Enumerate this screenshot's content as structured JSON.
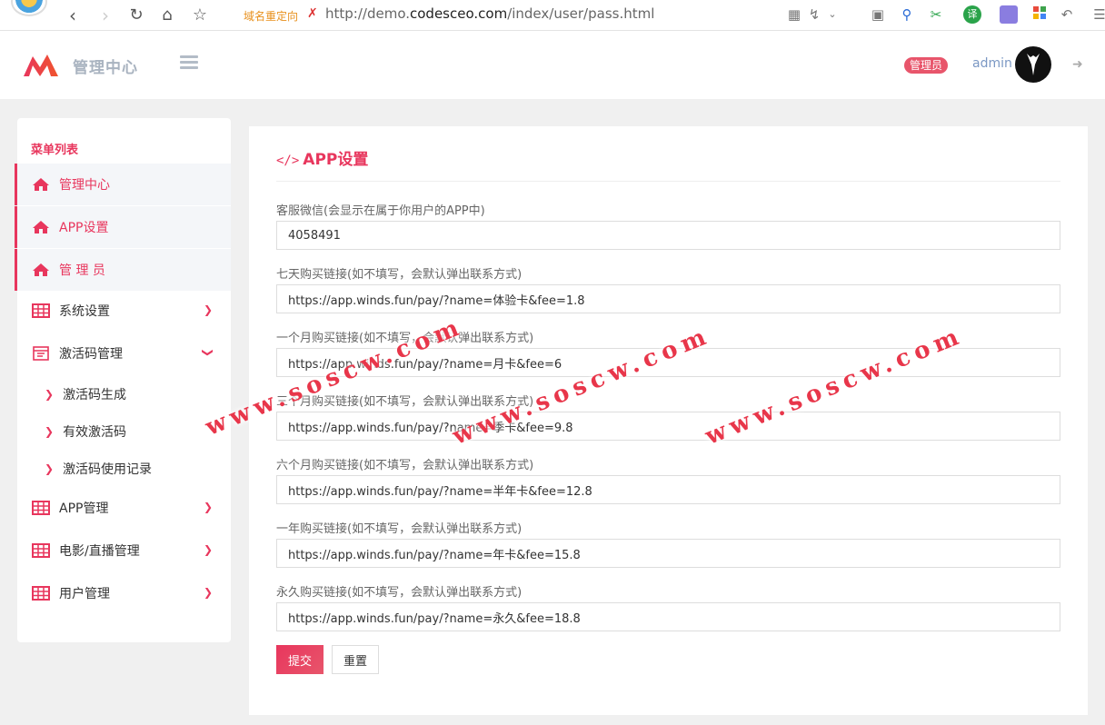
{
  "browser": {
    "redirect_label": "域名重定向",
    "url_prefix": "http://demo.",
    "url_domain": "codesceo.com",
    "url_path": "/index/user/pass.html"
  },
  "header": {
    "app_title": "管理中心",
    "role_badge": "管理员",
    "username": "admin"
  },
  "sidebar": {
    "title": "菜单列表",
    "items": [
      {
        "label": "管理中心",
        "icon": "home-icon",
        "active": true
      },
      {
        "label": "APP设置",
        "icon": "home-icon",
        "active": true
      },
      {
        "label": "管 理 员",
        "icon": "home-icon",
        "active": true
      },
      {
        "label": "系统设置",
        "icon": "table-icon",
        "chevron": "right"
      },
      {
        "label": "激活码管理",
        "icon": "calendar-icon",
        "chevron": "down"
      },
      {
        "label": "APP管理",
        "icon": "table-icon",
        "chevron": "right"
      },
      {
        "label": "电影/直播管理",
        "icon": "table-icon",
        "chevron": "right"
      },
      {
        "label": "用户管理",
        "icon": "table-icon",
        "chevron": "right"
      }
    ],
    "sub_items": [
      "激活码生成",
      "有效激活码",
      "激活码使用记录"
    ]
  },
  "main": {
    "title": "APP设置",
    "fields": [
      {
        "label": "客服微信(会显示在属于你用户的APP中)",
        "value": "4058491"
      },
      {
        "label": "七天购买链接(如不填写，会默认弹出联系方式)",
        "value": "https://app.winds.fun/pay/?name=体验卡&fee=1.8"
      },
      {
        "label": "一个月购买链接(如不填写，会默认弹出联系方式)",
        "value": "https://app.winds.fun/pay/?name=月卡&fee=6"
      },
      {
        "label": "三个月购买链接(如不填写，会默认弹出联系方式)",
        "value": "https://app.winds.fun/pay/?name=季卡&fee=9.8"
      },
      {
        "label": "六个月购买链接(如不填写，会默认弹出联系方式)",
        "value": "https://app.winds.fun/pay/?name=半年卡&fee=12.8"
      },
      {
        "label": "一年购买链接(如不填写，会默认弹出联系方式)",
        "value": "https://app.winds.fun/pay/?name=年卡&fee=15.8"
      },
      {
        "label": "永久购买链接(如不填写，会默认弹出联系方式)",
        "value": "https://app.winds.fun/pay/?name=永久&fee=18.8"
      }
    ],
    "submit_label": "提交",
    "reset_label": "重置"
  },
  "watermark": "www.soscw.com",
  "colors": {
    "accent": "#e8365d",
    "muted_title": "#a9b3c0"
  }
}
